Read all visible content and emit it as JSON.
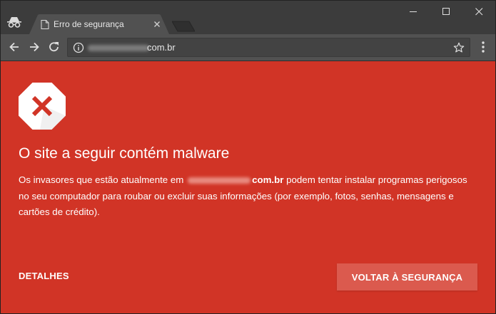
{
  "tab": {
    "title": "Erro de segurança"
  },
  "address_bar": {
    "domain": "com.br"
  },
  "colors": {
    "page_background": "#d13426",
    "button_background": "#db5a4e",
    "chrome_dark": "#3c3c3c",
    "toolbar": "#515151"
  },
  "icons": [
    "incognito-icon",
    "page-icon",
    "close-icon",
    "back-icon",
    "forward-icon",
    "reload-icon",
    "info-icon",
    "star-icon",
    "menu-icon",
    "minimize-icon",
    "maximize-icon",
    "window-close-icon",
    "malware-warning-icon"
  ],
  "interstitial": {
    "heading": "O site a seguir contém malware",
    "body_prefix": "Os invasores que estão atualmente em",
    "body_domain": "com.br",
    "body_suffix": "podem tentar instalar programas perigosos no seu computador para roubar ou excluir suas informações (por exemplo, fotos, senhas, mensagens e cartões de crédito).",
    "details_label": "DETALHES",
    "back_button_label": "VOLTAR À SEGURANÇA"
  }
}
